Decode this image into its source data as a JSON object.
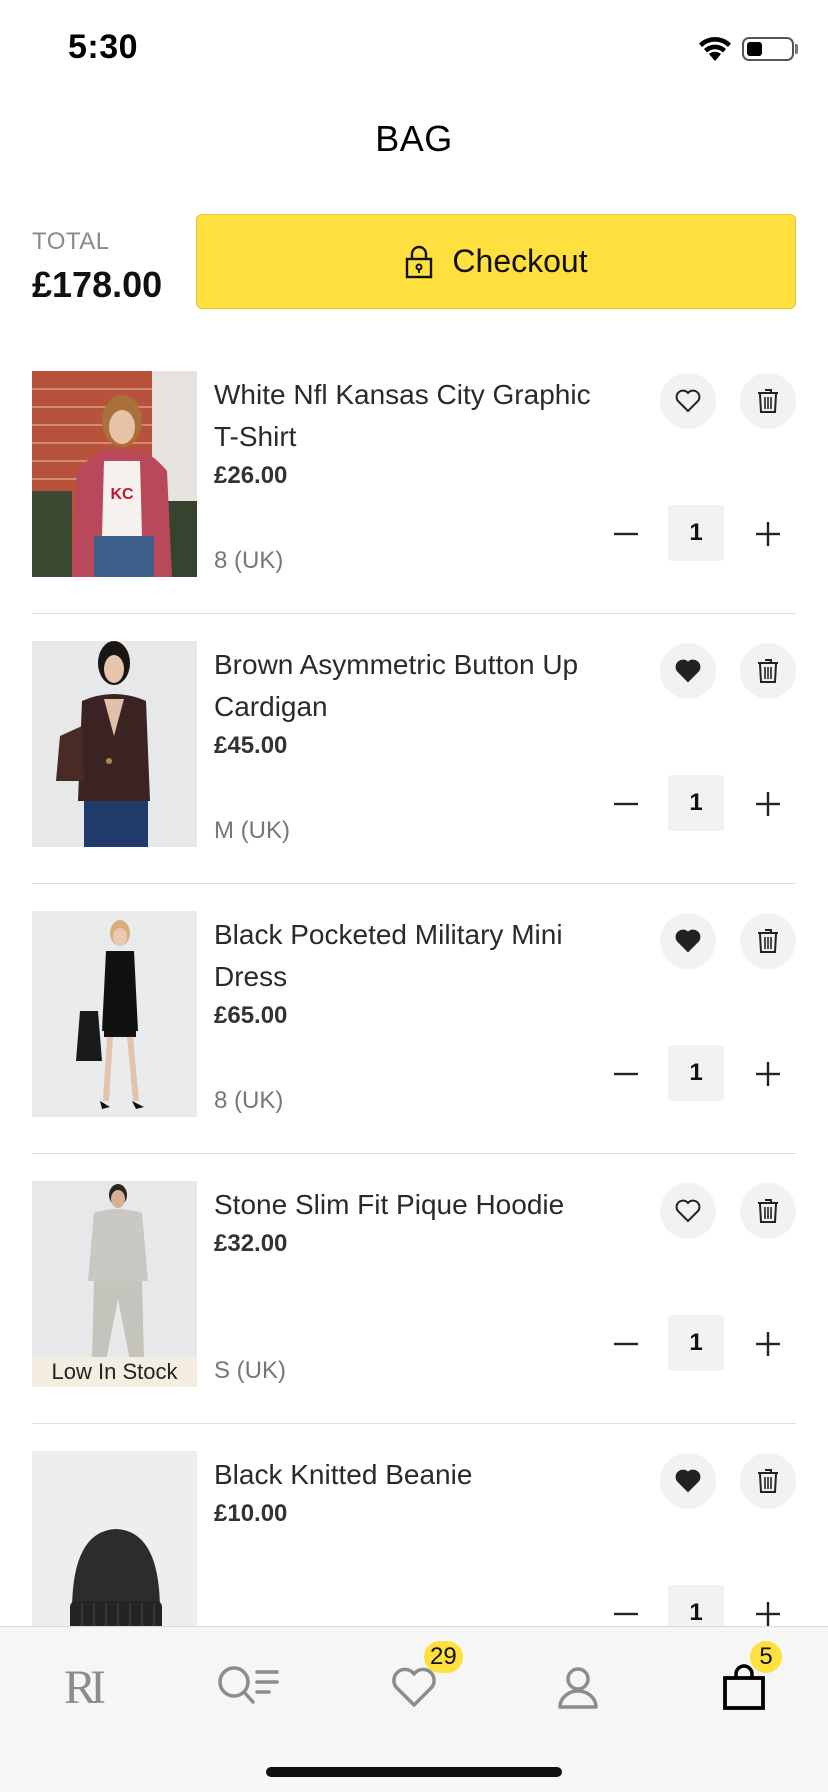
{
  "status_bar": {
    "time": "5:30",
    "battery_level": 0.35
  },
  "header": {
    "title": "BAG"
  },
  "summary": {
    "total_label": "TOTAL",
    "total_value": "£178.00",
    "checkout_label": "Checkout"
  },
  "items": [
    {
      "name": "White Nfl Kansas City Graphic T-Shirt",
      "price": "£26.00",
      "size": "8 (UK)",
      "quantity": "1",
      "wishlisted": false,
      "stock_badge": ""
    },
    {
      "name": "Brown Asymmetric Button Up Cardigan",
      "price": "£45.00",
      "size": "M (UK)",
      "quantity": "1",
      "wishlisted": true,
      "stock_badge": ""
    },
    {
      "name": "Black Pocketed Military Mini Dress",
      "price": "£65.00",
      "size": "8 (UK)",
      "quantity": "1",
      "wishlisted": true,
      "stock_badge": ""
    },
    {
      "name": "Stone Slim Fit Pique Hoodie",
      "price": "£32.00",
      "size": "S (UK)",
      "quantity": "1",
      "wishlisted": false,
      "stock_badge": "Low In Stock"
    },
    {
      "name": "Black Knitted Beanie",
      "price": "£10.00",
      "size": "",
      "quantity": "1",
      "wishlisted": true,
      "stock_badge": ""
    }
  ],
  "tab_bar": {
    "logo_text": "RI",
    "wishlist_count": "29",
    "bag_count": "5"
  },
  "colors": {
    "accent": "#ffe03f",
    "background": "#ffffff",
    "tab_bar_bg": "#f6f6f6"
  }
}
